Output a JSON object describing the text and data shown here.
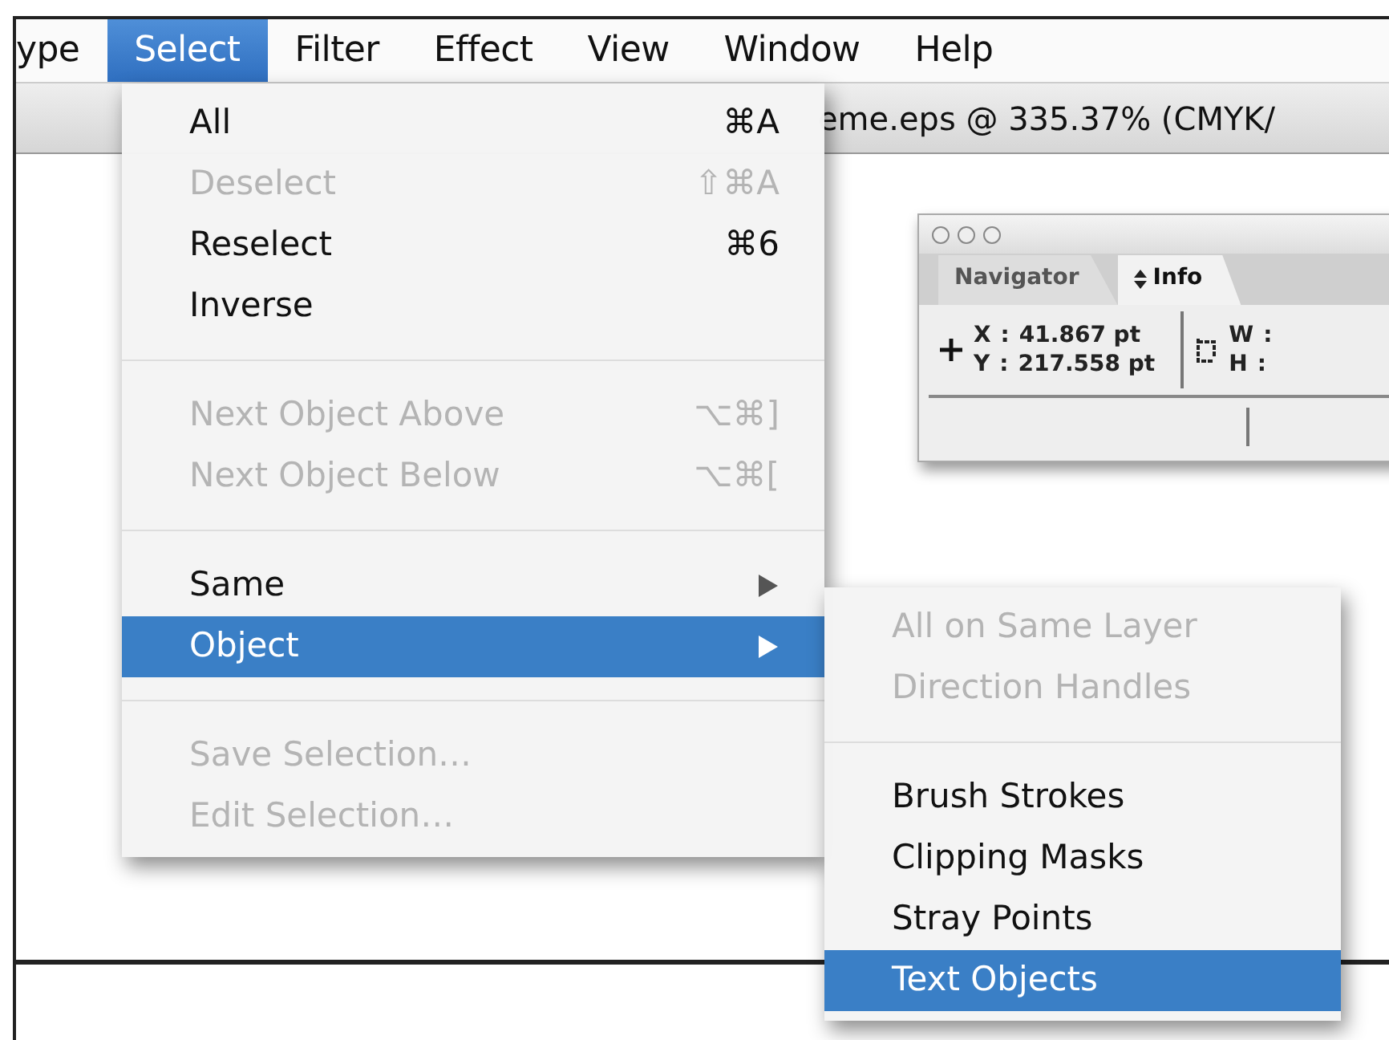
{
  "menu_bar": [
    {
      "label": "ype",
      "selected": false
    },
    {
      "label": "Select",
      "selected": true
    },
    {
      "label": "Filter",
      "selected": false
    },
    {
      "label": "Effect",
      "selected": false
    },
    {
      "label": "View",
      "selected": false
    },
    {
      "label": "Window",
      "selected": false
    },
    {
      "label": "Help",
      "selected": false
    }
  ],
  "document": {
    "title": "eme.eps @ 335.37% (CMYK/"
  },
  "info_panel": {
    "tabs": [
      {
        "label": "Navigator",
        "selected": false
      },
      {
        "label": "Info",
        "selected": true
      }
    ],
    "position": [
      {
        "label": "X",
        "separator": ":",
        "value": "41.867 pt"
      },
      {
        "label": "Y",
        "separator": ":",
        "value": "217.558 pt"
      }
    ],
    "size": [
      {
        "label": "W",
        "separator": ":"
      },
      {
        "label": "H",
        "separator": ":"
      }
    ]
  },
  "select_menu": [
    {
      "kind": "item",
      "label": "All",
      "shortcut": "⌘A",
      "disabled": false,
      "selected": false,
      "submenu": false
    },
    {
      "kind": "item",
      "label": "Deselect",
      "shortcut": "⇧⌘A",
      "disabled": true,
      "selected": false,
      "submenu": false
    },
    {
      "kind": "item",
      "label": "Reselect",
      "shortcut": "⌘6",
      "disabled": false,
      "selected": false,
      "submenu": false
    },
    {
      "kind": "item",
      "label": "Inverse",
      "disabled": false,
      "selected": false,
      "submenu": false
    },
    {
      "kind": "separator"
    },
    {
      "kind": "item",
      "label": "Next Object Above",
      "shortcut": "⌥⌘]",
      "disabled": true,
      "selected": false,
      "submenu": false
    },
    {
      "kind": "item",
      "label": "Next Object Below",
      "shortcut": "⌥⌘[",
      "disabled": true,
      "selected": false,
      "submenu": false
    },
    {
      "kind": "separator"
    },
    {
      "kind": "item",
      "label": "Same",
      "disabled": false,
      "selected": false,
      "submenu": true
    },
    {
      "kind": "item",
      "label": "Object",
      "disabled": false,
      "selected": true,
      "submenu": true
    },
    {
      "kind": "separator"
    },
    {
      "kind": "item",
      "label": "Save Selection…",
      "disabled": true,
      "selected": false,
      "submenu": false
    },
    {
      "kind": "item",
      "label": "Edit Selection…",
      "disabled": true,
      "selected": false,
      "submenu": false
    }
  ],
  "object_submenu": [
    {
      "kind": "item",
      "label": "All on Same Layer",
      "disabled": true,
      "selected": false
    },
    {
      "kind": "item",
      "label": "Direction Handles",
      "disabled": true,
      "selected": false
    },
    {
      "kind": "separator"
    },
    {
      "kind": "item",
      "label": "Brush Strokes",
      "disabled": false,
      "selected": false
    },
    {
      "kind": "item",
      "label": "Clipping Masks",
      "disabled": false,
      "selected": false
    },
    {
      "kind": "item",
      "label": "Stray Points",
      "disabled": false,
      "selected": false
    },
    {
      "kind": "item",
      "label": "Text Objects",
      "disabled": false,
      "selected": true
    }
  ]
}
